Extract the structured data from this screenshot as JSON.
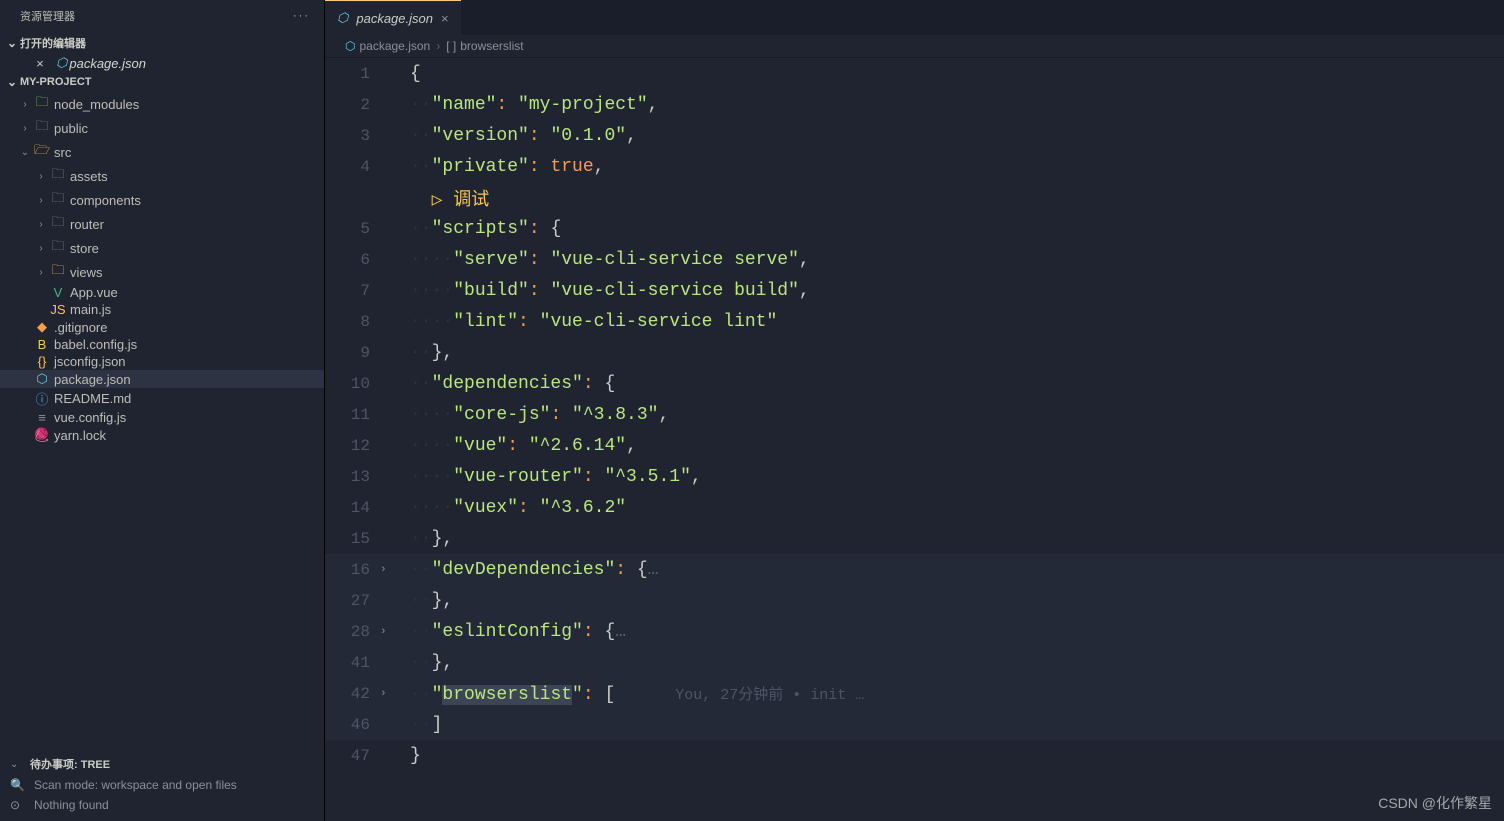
{
  "sidebar": {
    "title": "资源管理器",
    "sections": {
      "open_editors": "打开的编辑器",
      "project": "MY-PROJECT"
    },
    "open_files": [
      "package.json"
    ],
    "tree": [
      {
        "label": "node_modules",
        "depth": 1,
        "folder": true,
        "open": false,
        "color": "folder-green"
      },
      {
        "label": "public",
        "depth": 1,
        "folder": true,
        "open": false,
        "color": "folder-closed"
      },
      {
        "label": "src",
        "depth": 1,
        "folder": true,
        "open": true,
        "color": "folder-open-yellow"
      },
      {
        "label": "assets",
        "depth": 2,
        "folder": true,
        "open": false,
        "color": "folder-closed"
      },
      {
        "label": "components",
        "depth": 2,
        "folder": true,
        "open": false,
        "color": "folder-closed"
      },
      {
        "label": "router",
        "depth": 2,
        "folder": true,
        "open": false,
        "color": "folder-closed"
      },
      {
        "label": "store",
        "depth": 2,
        "folder": true,
        "open": false,
        "color": "folder-closed"
      },
      {
        "label": "views",
        "depth": 2,
        "folder": true,
        "open": false,
        "color": "folder-open-yellow"
      },
      {
        "label": "App.vue",
        "depth": 2,
        "folder": false,
        "color": "icon-vue",
        "icon": "V"
      },
      {
        "label": "main.js",
        "depth": 2,
        "folder": false,
        "color": "icon-yellow",
        "icon": "JS"
      },
      {
        "label": ".gitignore",
        "depth": 1,
        "folder": false,
        "color": "icon-orange",
        "icon": "◆"
      },
      {
        "label": "babel.config.js",
        "depth": 1,
        "folder": false,
        "color": "icon-yellow",
        "icon": "B"
      },
      {
        "label": "jsconfig.json",
        "depth": 1,
        "folder": false,
        "color": "icon-yellow",
        "icon": "{}"
      },
      {
        "label": "package.json",
        "depth": 1,
        "folder": false,
        "color": "icon-green",
        "icon": "⬡",
        "selected": true
      },
      {
        "label": "README.md",
        "depth": 1,
        "folder": false,
        "color": "icon-info",
        "icon": "ⓘ"
      },
      {
        "label": "vue.config.js",
        "depth": 1,
        "folder": false,
        "color": "icon-gray",
        "icon": "≡"
      },
      {
        "label": "yarn.lock",
        "depth": 1,
        "folder": false,
        "color": "icon-blue",
        "icon": "🧶"
      }
    ],
    "bottom": {
      "title": "待办事项: TREE",
      "scan_mode": "Scan mode: workspace and open files",
      "nothing": "Nothing found"
    }
  },
  "tab": {
    "label": "package.json"
  },
  "breadcrumb": {
    "file": "package.json",
    "path": "browserslist",
    "bracket": "[ ]"
  },
  "debug_codelens": "调试",
  "blame": "You, 27分钟前 • init …",
  "code": {
    "lines": [
      {
        "n": 1,
        "indent": 0,
        "tokens": [
          {
            "t": "brace",
            "v": "{"
          }
        ]
      },
      {
        "n": 2,
        "indent": 1,
        "tokens": [
          {
            "t": "key",
            "v": "\"name\""
          },
          {
            "t": "colon",
            "v": ": "
          },
          {
            "t": "str",
            "v": "\"my-project\""
          },
          {
            "t": "punc",
            "v": ","
          }
        ]
      },
      {
        "n": 3,
        "indent": 1,
        "tokens": [
          {
            "t": "key",
            "v": "\"version\""
          },
          {
            "t": "colon",
            "v": ": "
          },
          {
            "t": "str",
            "v": "\"0.1.0\""
          },
          {
            "t": "punc",
            "v": ","
          }
        ]
      },
      {
        "n": 4,
        "indent": 1,
        "tokens": [
          {
            "t": "key",
            "v": "\"private\""
          },
          {
            "t": "colon",
            "v": ": "
          },
          {
            "t": "const",
            "v": "true"
          },
          {
            "t": "punc",
            "v": ","
          }
        ]
      },
      {
        "n": null,
        "codelens": true
      },
      {
        "n": 5,
        "indent": 1,
        "tokens": [
          {
            "t": "key",
            "v": "\"scripts\""
          },
          {
            "t": "colon",
            "v": ": "
          },
          {
            "t": "brace",
            "v": "{"
          }
        ]
      },
      {
        "n": 6,
        "indent": 2,
        "tokens": [
          {
            "t": "key",
            "v": "\"serve\""
          },
          {
            "t": "colon",
            "v": ": "
          },
          {
            "t": "str",
            "v": "\"vue-cli-service serve\""
          },
          {
            "t": "punc",
            "v": ","
          }
        ]
      },
      {
        "n": 7,
        "indent": 2,
        "tokens": [
          {
            "t": "key",
            "v": "\"build\""
          },
          {
            "t": "colon",
            "v": ": "
          },
          {
            "t": "str",
            "v": "\"vue-cli-service build\""
          },
          {
            "t": "punc",
            "v": ","
          }
        ]
      },
      {
        "n": 8,
        "indent": 2,
        "tokens": [
          {
            "t": "key",
            "v": "\"lint\""
          },
          {
            "t": "colon",
            "v": ": "
          },
          {
            "t": "str",
            "v": "\"vue-cli-service lint\""
          }
        ]
      },
      {
        "n": 9,
        "indent": 1,
        "tokens": [
          {
            "t": "brace",
            "v": "}"
          },
          {
            "t": "punc",
            "v": ","
          }
        ]
      },
      {
        "n": 10,
        "indent": 1,
        "tokens": [
          {
            "t": "key",
            "v": "\"dependencies\""
          },
          {
            "t": "colon",
            "v": ": "
          },
          {
            "t": "brace",
            "v": "{"
          }
        ]
      },
      {
        "n": 11,
        "indent": 2,
        "tokens": [
          {
            "t": "key",
            "v": "\"core-js\""
          },
          {
            "t": "colon",
            "v": ": "
          },
          {
            "t": "str",
            "v": "\"^3.8.3\""
          },
          {
            "t": "punc",
            "v": ","
          }
        ]
      },
      {
        "n": 12,
        "indent": 2,
        "tokens": [
          {
            "t": "key",
            "v": "\"vue\""
          },
          {
            "t": "colon",
            "v": ": "
          },
          {
            "t": "str",
            "v": "\"^2.6.14\""
          },
          {
            "t": "punc",
            "v": ","
          }
        ]
      },
      {
        "n": 13,
        "indent": 2,
        "tokens": [
          {
            "t": "key",
            "v": "\"vue-router\""
          },
          {
            "t": "colon",
            "v": ": "
          },
          {
            "t": "str",
            "v": "\"^3.5.1\""
          },
          {
            "t": "punc",
            "v": ","
          }
        ]
      },
      {
        "n": 14,
        "indent": 2,
        "tokens": [
          {
            "t": "key",
            "v": "\"vuex\""
          },
          {
            "t": "colon",
            "v": ": "
          },
          {
            "t": "str",
            "v": "\"^3.6.2\""
          }
        ]
      },
      {
        "n": 15,
        "indent": 1,
        "tokens": [
          {
            "t": "brace",
            "v": "}"
          },
          {
            "t": "punc",
            "v": ","
          }
        ]
      },
      {
        "n": 16,
        "indent": 1,
        "fold": true,
        "hl": true,
        "tokens": [
          {
            "t": "key",
            "v": "\"devDependencies\""
          },
          {
            "t": "colon",
            "v": ": "
          },
          {
            "t": "brace",
            "v": "{"
          },
          {
            "t": "dots",
            "v": "…"
          }
        ]
      },
      {
        "n": 27,
        "indent": 1,
        "hl": true,
        "tokens": [
          {
            "t": "brace",
            "v": "}"
          },
          {
            "t": "punc",
            "v": ","
          }
        ]
      },
      {
        "n": 28,
        "indent": 1,
        "fold": true,
        "hl": true,
        "tokens": [
          {
            "t": "key",
            "v": "\"eslintConfig\""
          },
          {
            "t": "colon",
            "v": ": "
          },
          {
            "t": "brace",
            "v": "{"
          },
          {
            "t": "dots",
            "v": "…"
          }
        ]
      },
      {
        "n": 41,
        "indent": 1,
        "hl": true,
        "tokens": [
          {
            "t": "brace",
            "v": "}"
          },
          {
            "t": "punc",
            "v": ","
          }
        ]
      },
      {
        "n": 42,
        "indent": 1,
        "fold": true,
        "hl": true,
        "cursor": true,
        "tokens": [
          {
            "t": "key",
            "v": "\"",
            "sel": false
          },
          {
            "t": "key",
            "v": "browserslist",
            "sel": true
          },
          {
            "t": "key",
            "v": "\""
          },
          {
            "t": "colon",
            "v": ": "
          },
          {
            "t": "brace",
            "v": "["
          }
        ],
        "blame": true
      },
      {
        "n": 46,
        "indent": 1,
        "hl": true,
        "tokens": [
          {
            "t": "brace",
            "v": "]"
          }
        ]
      },
      {
        "n": 47,
        "indent": 0,
        "tokens": [
          {
            "t": "brace",
            "v": "}"
          }
        ]
      }
    ]
  },
  "watermark": "CSDN @化作繁星"
}
